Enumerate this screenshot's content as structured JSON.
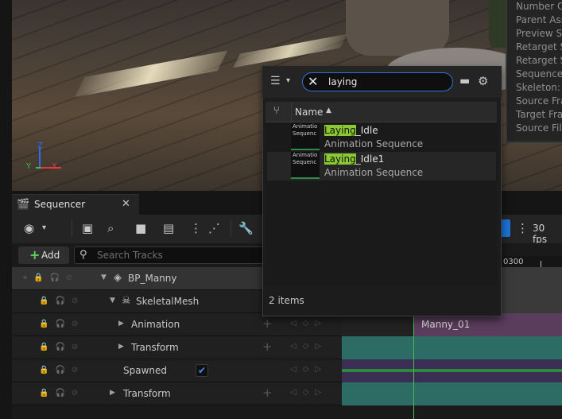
{
  "details_panel": {
    "rows": [
      "Number O",
      "Parent Ass",
      "Preview S",
      "Retarget S",
      "Retarget S",
      "Sequence",
      "Skeleton: A",
      "Source Fra",
      "Target Fra",
      "Source File"
    ]
  },
  "sequencer": {
    "tab_label": "Sequencer",
    "add_label": "Add",
    "search_placeholder": "Search Tracks",
    "fps_label": "30 fps",
    "timeline_tick": "0300",
    "tracks": [
      {
        "label": "BP_Manny"
      },
      {
        "label": "SkeletalMesh"
      },
      {
        "label": "Animation"
      },
      {
        "label": "Transform"
      },
      {
        "label": "Spawned"
      },
      {
        "label": "Transform"
      }
    ],
    "section_label": "Manny_01"
  },
  "picker": {
    "search_value": "laying",
    "column_name": "Name",
    "items": [
      {
        "match": "Laying",
        "rest": "_Idle",
        "type": "Animation Sequence",
        "thumb_text": [
          "Animatio",
          "Sequenc"
        ]
      },
      {
        "match": "Laying",
        "rest": "_Idle1",
        "type": "Animation Sequence",
        "thumb_text": [
          "Animatio",
          "Sequenc"
        ]
      }
    ],
    "count_label": "2 items"
  },
  "viewport": {
    "axis_labels": {
      "z": "Z",
      "y": "Y",
      "x": "X"
    }
  },
  "colors": {
    "accent": "#2f74d6",
    "highlight": "#8cc832",
    "playhead": "#4cbf4c"
  }
}
